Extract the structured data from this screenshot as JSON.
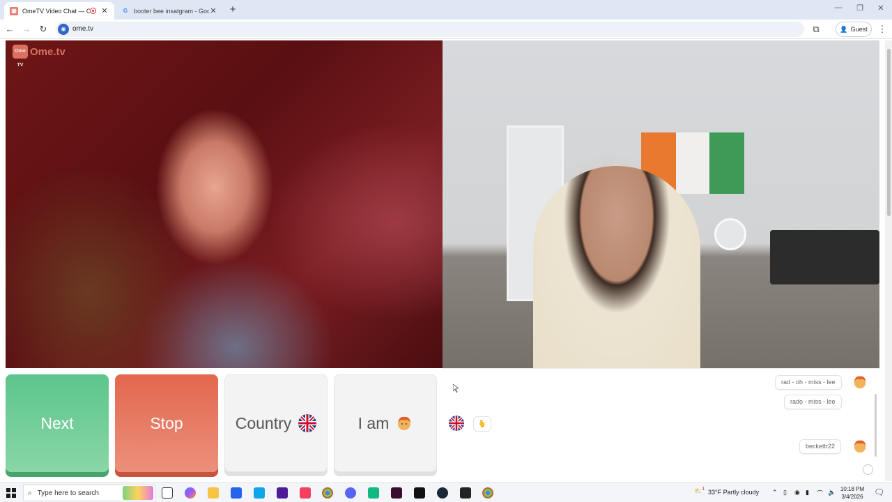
{
  "browser": {
    "tabs": [
      {
        "title": "OmeTV Video Chat — Ome",
        "active": true
      },
      {
        "title": "booter bee insatgram - Google",
        "active": false
      }
    ],
    "url": "ome.tv",
    "profile_label": "Guest"
  },
  "page": {
    "logo_text": "Ome.tv",
    "logo_badge": "Ome TV",
    "controls": {
      "next_label": "Next",
      "stop_label": "Stop",
      "country_label": "Country",
      "iam_label": "I am"
    },
    "chat": {
      "messages": [
        {
          "text": "rad - oh - miss - lee",
          "avatar": true
        },
        {
          "text": "rado - miss - lee",
          "avatar": false
        },
        {
          "text": "beckettr22",
          "avatar": true
        }
      ]
    }
  },
  "taskbar": {
    "search_placeholder": "Type here to search",
    "weather": "33°F  Partly cloudy",
    "weather_badge": "1",
    "time": "10:18 PM",
    "date": "3/4/2026"
  },
  "colors": {
    "next": "#5cc58b",
    "stop": "#e3674e",
    "brand": "#e87a6a"
  }
}
